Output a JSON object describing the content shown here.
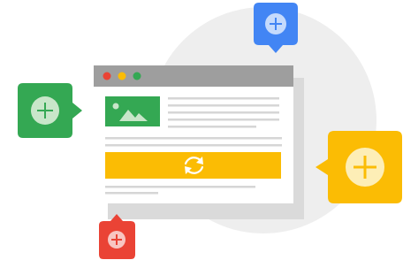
{
  "illustration": {
    "colors": {
      "background_circle": "#eeeeee",
      "window_shadow": "#dadada",
      "window_frame": "#9e9e9e",
      "window_body": "#ffffff",
      "text_line": "#d6d6d6",
      "image_tile": "#34a853",
      "banner": "#fbbc04",
      "dot_red": "#ea4335",
      "dot_yellow": "#fbbc04",
      "dot_green": "#34a853"
    },
    "icons": {
      "image": "landscape-image-icon",
      "banner": "refresh-icon",
      "badges": "add-circle-icon"
    },
    "badges": [
      {
        "name": "blue-add-badge",
        "color": "#4285f4"
      },
      {
        "name": "green-add-badge",
        "color": "#34a853"
      },
      {
        "name": "yellow-add-badge",
        "color": "#fbbc04"
      },
      {
        "name": "red-add-badge",
        "color": "#ea4335"
      }
    ]
  }
}
